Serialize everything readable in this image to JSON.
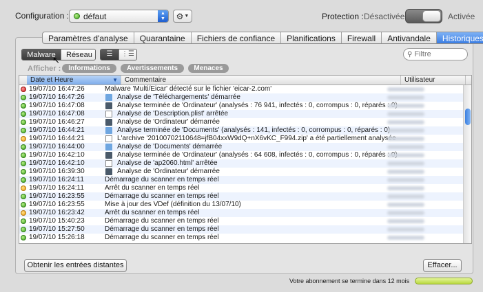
{
  "top": {
    "config_label": "Configuration :",
    "config_value": "défaut",
    "protection_label": "Protection :",
    "protection_off": "Désactivée",
    "protection_on": "Activée",
    "protection_state": "off"
  },
  "tabs": [
    {
      "label": "Paramètres d'analyse",
      "active": false
    },
    {
      "label": "Quarantaine",
      "active": false
    },
    {
      "label": "Fichiers de confiance",
      "active": false
    },
    {
      "label": "Planifications",
      "active": false
    },
    {
      "label": "Firewall",
      "active": false
    },
    {
      "label": "Antivandale",
      "active": false
    },
    {
      "label": "Historiques",
      "active": true
    }
  ],
  "segments": {
    "malware": "Malware",
    "reseau": "Réseau",
    "selected": "Malware"
  },
  "search": {
    "placeholder": "Filtre",
    "icon": "search-icon"
  },
  "filters": {
    "label": "Afficher :",
    "info": "Informations",
    "warnings": "Avertissements",
    "threats": "Menaces"
  },
  "table": {
    "columns": [
      "Date et Heure",
      "Commentaire",
      "Utilisateur"
    ],
    "rows": [
      {
        "status": "red",
        "date": "19/07/10 16:47:26",
        "icon": "",
        "comment": "Malware 'Multi/Eicar' détecté sur le fichier 'eicar-2.com'"
      },
      {
        "status": "green",
        "date": "19/07/10 16:47:26",
        "icon": "folder",
        "comment": "Analyse de 'Téléchargements' démarrée"
      },
      {
        "status": "green",
        "date": "19/07/10 16:47:08",
        "icon": "computer",
        "comment": "Analyse terminée de 'Ordinateur' (analysés : 76 941, infectés : 0, corrompus : 0, réparés : 0)"
      },
      {
        "status": "green",
        "date": "19/07/10 16:47:08",
        "icon": "file",
        "comment": "Analyse de 'Description.plist' arrêtée"
      },
      {
        "status": "green",
        "date": "19/07/10 16:46:27",
        "icon": "computer",
        "comment": "Analyse de 'Ordinateur' démarrée"
      },
      {
        "status": "green",
        "date": "19/07/10 16:44:21",
        "icon": "folder",
        "comment": "Analyse terminée de 'Documents' (analysés : 141, infectés : 0, corrompus : 0, réparés : 0)"
      },
      {
        "status": "orange",
        "date": "19/07/10 16:44:21",
        "icon": "file",
        "comment": "L'archive '20100702110648=jfB04xxW9dQ+nX6vKC_F994.zip' a été partiellement analysée"
      },
      {
        "status": "green",
        "date": "19/07/10 16:44:00",
        "icon": "folder",
        "comment": "Analyse de 'Documents' démarrée"
      },
      {
        "status": "green",
        "date": "19/07/10 16:42:10",
        "icon": "computer",
        "comment": "Analyse terminée de 'Ordinateur' (analysés : 64 608, infectés : 0, corrompus : 0, réparés : 0)"
      },
      {
        "status": "green",
        "date": "19/07/10 16:42:10",
        "icon": "file",
        "comment": "Analyse de 'ap2060.html' arrêtée"
      },
      {
        "status": "green",
        "date": "19/07/10 16:39:30",
        "icon": "computer",
        "comment": "Analyse de 'Ordinateur' démarrée"
      },
      {
        "status": "green",
        "date": "19/07/10 16:24:11",
        "icon": "",
        "comment": "Démarrage du scanner en temps réel"
      },
      {
        "status": "orange",
        "date": "19/07/10 16:24:11",
        "icon": "",
        "comment": "Arrêt du scanner en temps réel"
      },
      {
        "status": "green",
        "date": "19/07/10 16:23:55",
        "icon": "",
        "comment": "Démarrage du scanner en temps réel"
      },
      {
        "status": "green",
        "date": "19/07/10 16:23:55",
        "icon": "",
        "comment": "Mise à jour des VDef (définition du 13/07/10)"
      },
      {
        "status": "orange",
        "date": "19/07/10 16:23:42",
        "icon": "",
        "comment": "Arrêt du scanner en temps réel"
      },
      {
        "status": "green",
        "date": "19/07/10 15:40:23",
        "icon": "",
        "comment": "Démarrage du scanner en temps réel"
      },
      {
        "status": "green",
        "date": "19/07/10 15:27:50",
        "icon": "",
        "comment": "Démarrage du scanner en temps réel"
      },
      {
        "status": "green",
        "date": "19/07/10 15:26:18",
        "icon": "",
        "comment": "Démarrage du scanner en temps réel"
      }
    ]
  },
  "buttons": {
    "remote": "Obtenir les entrées distantes",
    "clear": "Effacer..."
  },
  "subscription": {
    "text": "Votre abonnement se termine dans 12 mois"
  }
}
